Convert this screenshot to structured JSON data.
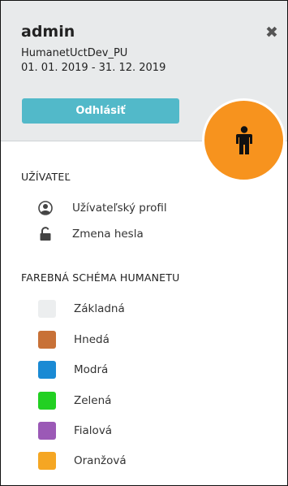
{
  "account": {
    "username": "admin",
    "company": "HumanetUctDev_PU",
    "period": "01. 01. 2019 - 31. 12. 2019",
    "logout_label": "Odhlásiť"
  },
  "user_section": {
    "title": "UŽÍVATEĽ",
    "items": [
      {
        "label": "Užívateľský profil",
        "icon": "user-circle-icon"
      },
      {
        "label": "Zmena hesla",
        "icon": "unlock-icon"
      }
    ]
  },
  "color_scheme": {
    "title": "FAREBNÁ SCHÉMA HUMANETU",
    "items": [
      {
        "label": "Základná",
        "color": "#eceeef"
      },
      {
        "label": "Hnedá",
        "color": "#c87137"
      },
      {
        "label": "Modrá",
        "color": "#1a8ad4"
      },
      {
        "label": "Zelená",
        "color": "#22d022"
      },
      {
        "label": "Fialová",
        "color": "#9b59b6"
      },
      {
        "label": "Oranžová",
        "color": "#f5a623"
      }
    ]
  },
  "colors": {
    "accent": "#52b9c9",
    "avatar_bg": "#f7931e",
    "header_bg": "#e8eaeb"
  }
}
